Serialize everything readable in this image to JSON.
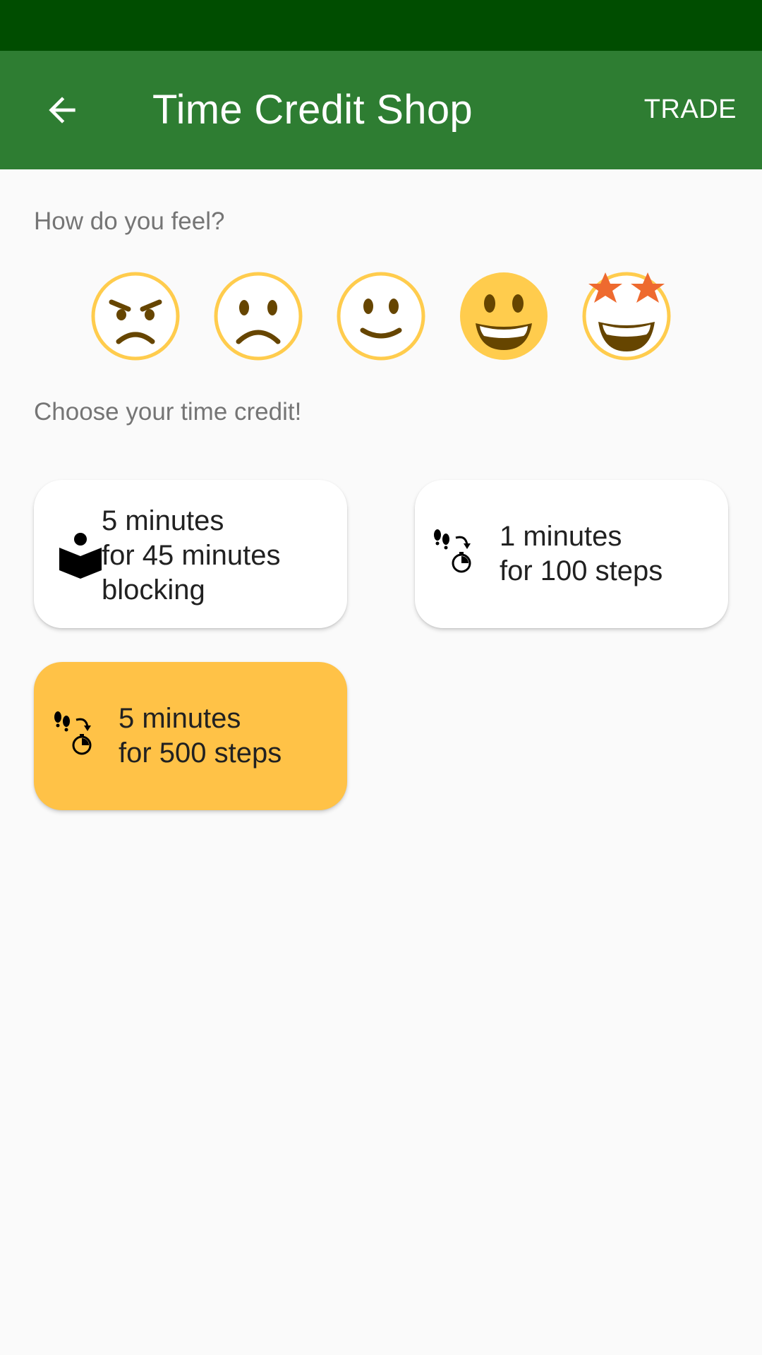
{
  "app_bar": {
    "title": "Time Credit Shop",
    "trade_label": "TRADE",
    "back_icon": "arrow-back-icon",
    "color": "#2e7d32"
  },
  "status_bar": {
    "color": "#004d00"
  },
  "mood": {
    "prompt": "How do you feel?",
    "options": [
      {
        "name": "angry",
        "icon": "angry-face-icon",
        "selected": false
      },
      {
        "name": "sad",
        "icon": "frowning-face-icon",
        "selected": false
      },
      {
        "name": "neutral",
        "icon": "slightly-smiling-face-icon",
        "selected": false
      },
      {
        "name": "happy",
        "icon": "grinning-face-icon",
        "selected": true
      },
      {
        "name": "excited",
        "icon": "star-struck-face-icon",
        "selected": false
      }
    ]
  },
  "credits": {
    "prompt": "Choose your time credit!",
    "items": [
      {
        "line1": "5 minutes",
        "line2": "for 45 minutes",
        "line3": "blocking",
        "icon": "reading-person-icon",
        "selected": false
      },
      {
        "line1": "1 minutes",
        "line2": "for 100 steps",
        "icon": "steps-timer-icon",
        "selected": false
      },
      {
        "line1": "5 minutes",
        "line2": "for 500 steps",
        "icon": "steps-timer-icon",
        "selected": true
      }
    ],
    "selected_color": "#ffc247"
  }
}
